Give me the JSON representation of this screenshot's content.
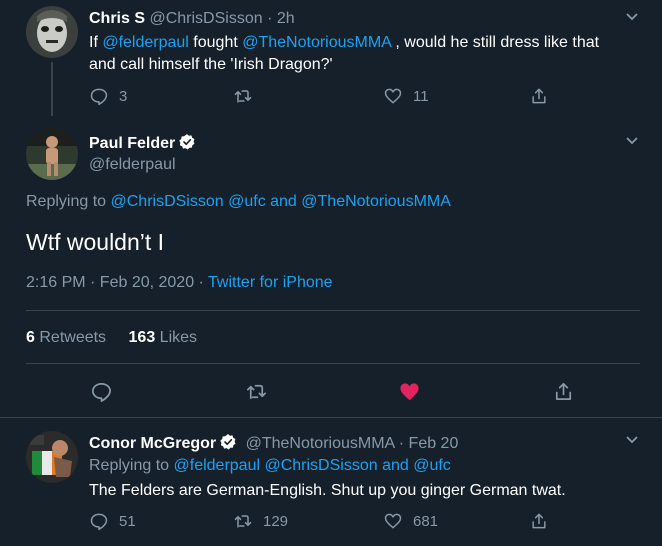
{
  "tweet1": {
    "name": "Chris S",
    "handle": "@ChrisDSisson",
    "time": "· 2h",
    "text_parts": [
      "If ",
      "@felderpaul",
      " fought ",
      "@TheNotoriousMMA",
      " , would he still dress like that",
      "and call himself the 'Irish Dragon?'"
    ],
    "replies": "3",
    "likes": "11"
  },
  "main_tweet": {
    "name": "Paul Felder",
    "handle": "@felderpaul",
    "replying_label": "Replying to",
    "replying_to": "@ChrisDSisson @ufc and @TheNotoriousMMA",
    "text": "Wtf wouldn’t I",
    "timestamp": "2:16 PM · Feb 20, 2020 · ",
    "source": "Twitter for iPhone",
    "retweet_count": "6",
    "retweet_label": "Retweets",
    "like_count": "163",
    "like_label": "Likes",
    "like_color": "#e0245e"
  },
  "tweet3": {
    "name": "Conor McGregor",
    "handle": "@TheNotoriousMMA",
    "time": "· Feb 20",
    "replying_label": "Replying to",
    "replying_to": "@felderpaul @ChrisDSisson and @ufc",
    "text": "The Felders are German-English. Shut up you ginger German twat.",
    "replies": "51",
    "retweets": "129",
    "likes": "681"
  },
  "colors": {
    "background": "#15202b",
    "accent": "#1da1f2",
    "muted": "#8899a6",
    "divider": "#38444d"
  }
}
